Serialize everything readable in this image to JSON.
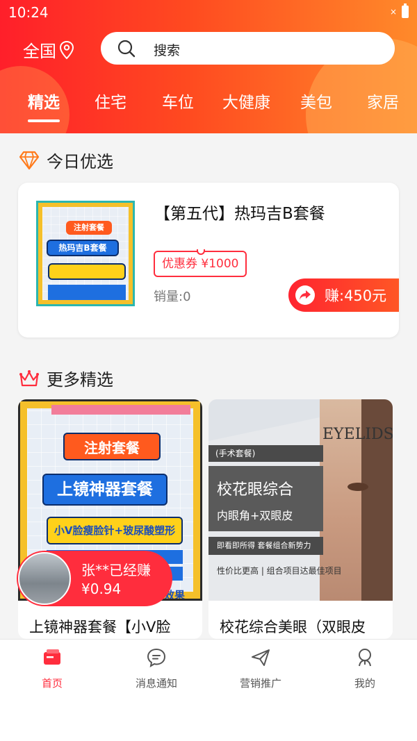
{
  "status_bar": {
    "time": "10:24",
    "close_glyph": "×"
  },
  "header": {
    "region": "全国",
    "search_placeholder": "搜索",
    "tabs": [
      {
        "label": "精选",
        "active": true
      },
      {
        "label": "住宅",
        "active": false
      },
      {
        "label": "车位",
        "active": false
      },
      {
        "label": "大健康",
        "active": false
      },
      {
        "label": "美包",
        "active": false
      },
      {
        "label": "家居",
        "active": false
      }
    ]
  },
  "today": {
    "section_title": "今日优选",
    "product": {
      "title": "【第五代】热玛吉B套餐",
      "coupon": "优惠券 ¥1000",
      "sales": "销量:0",
      "earn": "赚:450元",
      "thumb": {
        "badge1": "注射套餐",
        "badge2": "热玛吉B套餐"
      }
    }
  },
  "more": {
    "section_title": "更多精选",
    "items": [
      {
        "name": "上镜神器套餐【小V脸",
        "img_text": {
          "t1": "注射套餐",
          "t2": "上镜神器套餐",
          "t3": "小V脸瘦脸针+玻尿酸塑形",
          "t4": "效果"
        }
      },
      {
        "name": "校花综合美眼（双眼皮",
        "img_text": {
          "brand": "EYELIDS",
          "tag": "(手术套餐)",
          "title": "校花眼综合",
          "subtitle": "内眼角+双眼皮",
          "line1": "即看即所得 套餐组合新势力",
          "line2": "性价比更高 | 组合项目达最佳项目"
        }
      }
    ]
  },
  "toast": {
    "line1": "张**已经赚",
    "line2": "¥0.94"
  },
  "bottom_nav": [
    {
      "label": "首页",
      "icon": "home-card-icon",
      "active": true
    },
    {
      "label": "消息通知",
      "icon": "chat-bubble-icon",
      "active": false
    },
    {
      "label": "营销推广",
      "icon": "paper-plane-icon",
      "active": false
    },
    {
      "label": "我的",
      "icon": "user-icon",
      "active": false
    }
  ],
  "colors": {
    "accent": "#ff2d3d",
    "header_start": "#ff1f2a",
    "header_end": "#ff8a2a"
  }
}
